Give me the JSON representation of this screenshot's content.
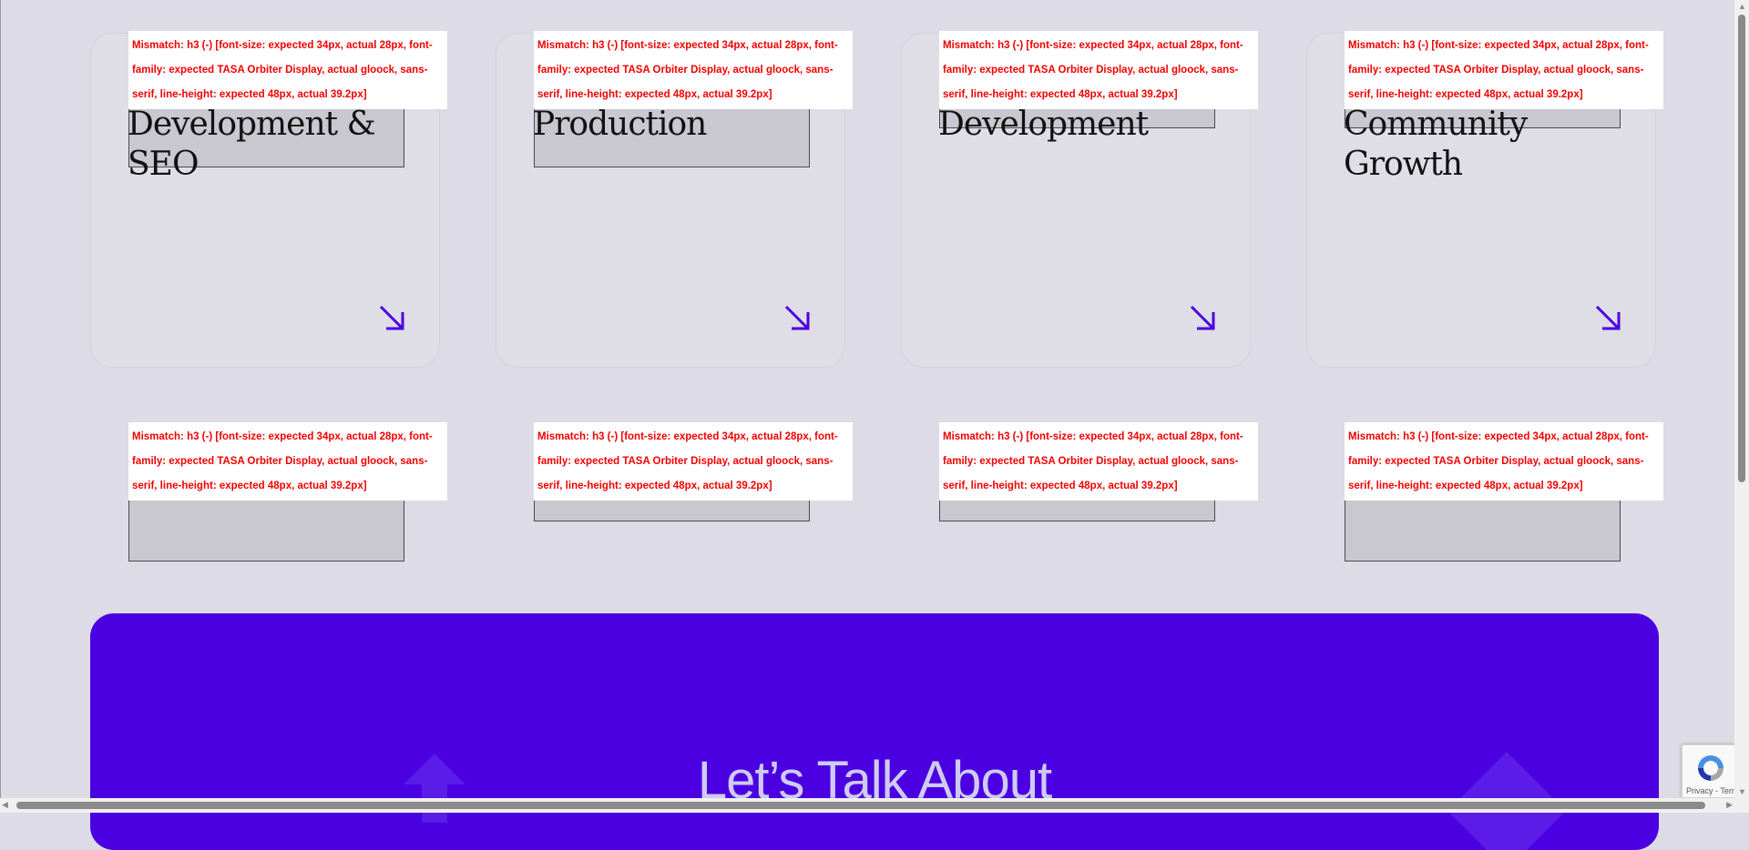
{
  "mismatch_message": "Mismatch: h3 (-) [font-size: expected 34px, actual 28px, font-family: expected TASA Orbiter Display, actual gloock, sans-serif, line-height: expected 48px, actual 39.2px]",
  "cards": [
    {
      "title": "Development & SEO",
      "arrow_icon": "arrow-down-right-icon"
    },
    {
      "title": "Production",
      "arrow_icon": "arrow-down-right-icon"
    },
    {
      "title": "Development",
      "arrow_icon": "arrow-down-right-icon"
    },
    {
      "title": "Community Growth",
      "arrow_icon": "arrow-down-right-icon"
    }
  ],
  "cta": {
    "title": "Let’s Talk About"
  },
  "recaptcha": {
    "links": "Privacy - Terms"
  },
  "colors": {
    "page_background": "#dddbe5",
    "accent": "#4a00e0",
    "arrow": "#4a00e0",
    "mismatch_text": "#f20000",
    "cta_text": "#cfcaf3"
  }
}
